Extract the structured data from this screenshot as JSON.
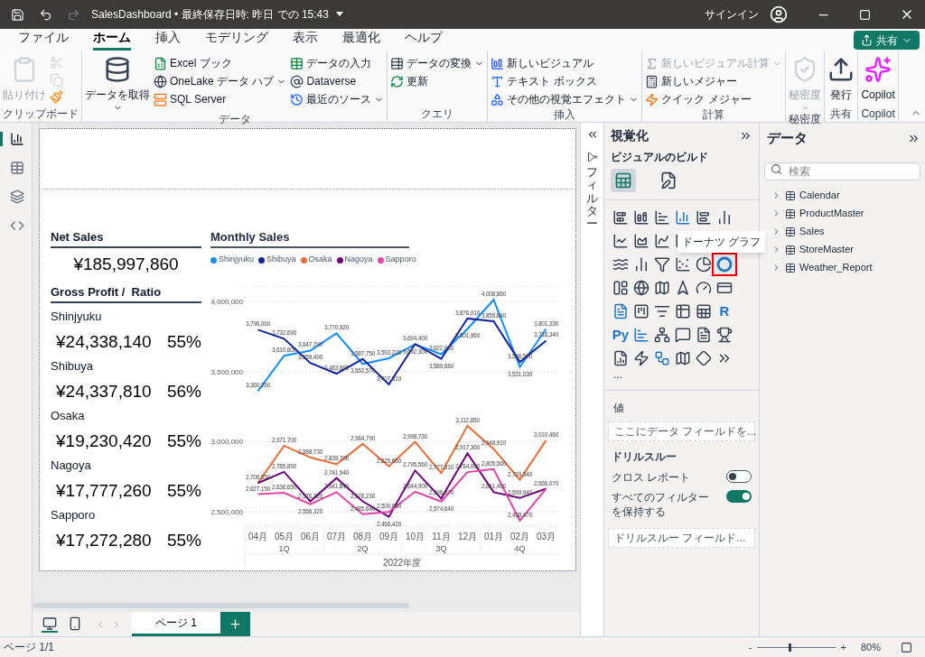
{
  "window": {
    "title": "SalesDashboard • 最終保存日時: 昨日 での 15:43",
    "signin": "サインイン"
  },
  "menu_tabs": [
    {
      "label": "ファイル",
      "selected": false
    },
    {
      "label": "ホーム",
      "selected": true
    },
    {
      "label": "挿入",
      "selected": false
    },
    {
      "label": "モデリング",
      "selected": false
    },
    {
      "label": "表示",
      "selected": false
    },
    {
      "label": "最適化",
      "selected": false
    },
    {
      "label": "ヘルプ",
      "selected": false
    }
  ],
  "share_button": "共有",
  "clipboard_tools": [
    {
      "disabled": true
    },
    {
      "disabled": true
    },
    {
      "disabled": false
    }
  ],
  "ribbon_groups": [
    {
      "label": "クリップボード",
      "large": {
        "label": "貼り付け",
        "dropdown": false,
        "disabled": true
      }
    },
    {
      "label": "データ",
      "large": {
        "label": "データを取得",
        "dropdown": true,
        "disabled": false
      },
      "small": [
        {
          "label": "Excel ブック",
          "dropdown": false,
          "disabled": false
        },
        {
          "label": "OneLake データ ハブ",
          "dropdown": true,
          "disabled": false
        },
        {
          "label": "SQL Server",
          "dropdown": false,
          "disabled": false
        },
        {
          "label": "データの入力",
          "dropdown": false,
          "disabled": false
        },
        {
          "label": "Dataverse",
          "dropdown": false,
          "disabled": false
        },
        {
          "label": "最近のソース",
          "dropdown": true,
          "disabled": false
        }
      ]
    },
    {
      "label": "クエリ",
      "small": [
        {
          "label": "データの変換",
          "dropdown": true,
          "disabled": false
        },
        {
          "label": "更新",
          "dropdown": false,
          "disabled": false
        }
      ]
    },
    {
      "label": "挿入",
      "small": [
        {
          "label": "新しいビジュアル",
          "dropdown": false,
          "disabled": false
        },
        {
          "label": "テキスト ボックス",
          "dropdown": false,
          "disabled": false
        },
        {
          "label": "その他の視覚エフェクト",
          "dropdown": true,
          "disabled": false
        }
      ]
    },
    {
      "label": "計算",
      "small": [
        {
          "label": "新しいビジュアル計算",
          "dropdown": true,
          "disabled": true
        },
        {
          "label": "新しいメジャー",
          "dropdown": false,
          "disabled": false
        },
        {
          "label": "クイック メジャー",
          "dropdown": false,
          "disabled": false
        }
      ]
    },
    {
      "label": "秘密度",
      "large": {
        "label": "秘密度",
        "dropdown": true,
        "disabled": true
      }
    },
    {
      "label": "共有",
      "large": {
        "label": "発行",
        "dropdown": false,
        "disabled": false
      }
    },
    {
      "label": "Copilot",
      "large": {
        "label": "Copilot",
        "dropdown": false,
        "disabled": false
      }
    }
  ],
  "views": [
    {
      "selected": true
    },
    {
      "selected": false
    },
    {
      "selected": false
    },
    {
      "selected": false
    }
  ],
  "kpi": {
    "net_sales_title": "Net Sales",
    "net_sales_value": "¥185,997,860",
    "gross_title": "Gross Profit /  Ratio",
    "stores": [
      {
        "name": "Shinjyuku",
        "profit": "¥24,338,140",
        "ratio": "55%"
      },
      {
        "name": "Shibuya",
        "profit": "¥24,337,810",
        "ratio": "56%"
      },
      {
        "name": "Osaka",
        "profit": "¥19,230,420",
        "ratio": "55%"
      },
      {
        "name": "Nagoya",
        "profit": "¥17,777,260",
        "ratio": "55%"
      },
      {
        "name": "Sapporo",
        "profit": "¥17,272,280",
        "ratio": "55%"
      }
    ]
  },
  "chart": {
    "title": "Monthly Sales",
    "quarters": [
      "1Q",
      "2Q",
      "3Q",
      "4Q"
    ],
    "fiscal_year": "2022年度",
    "chart_data": {
      "type": "line",
      "categories": [
        "04月",
        "05月",
        "06月",
        "07月",
        "08月",
        "09月",
        "10月",
        "11月",
        "12月",
        "01月",
        "02月",
        "03月"
      ],
      "series": [
        {
          "name": "Shinjyuku",
          "color": "#118dff",
          "values": [
            3360260,
            3610800,
            3647790,
            3770920,
            3552570,
            3593220,
            3692300,
            3622080,
            3801960,
            4008860,
            3531030,
            3801330
          ],
          "value_labels": [
            "3,360,260",
            "3,610,800",
            "3,647,790",
            "3,770,920",
            "3,552,570",
            "3,593,220",
            "3,692,300",
            "3,622,080",
            "3,801,960",
            "4,008,860",
            "3,531,030",
            "3,801,330"
          ]
        },
        {
          "name": "Shibuya",
          "color": "#12239e",
          "values": [
            3796060,
            3732690,
            3559490,
            3483880,
            3587750,
            3407810,
            3694400,
            3589680,
            3876010,
            3855840,
            3566590,
            3718340
          ],
          "value_labels": [
            "3,796,060",
            "3,732,690",
            "3,559,490",
            "3,483,880",
            "3,587,750",
            "3,407,810",
            "3,694,400",
            "3,589,680",
            "3,876,010",
            "3,855,840",
            "3,566,590",
            "3,718,340"
          ]
        },
        {
          "name": "Osaka",
          "color": "#e66c37",
          "values": [
            2706050,
            2971700,
            2888730,
            2839700,
            2984790,
            2825660,
            2998730,
            2777310,
            3112850,
            2948910,
            2729340,
            3010460
          ],
          "value_labels": [
            "2,706,050",
            "2,971,700",
            "2,888,730",
            "2,839,700",
            "2,984,790",
            "2,825,660",
            "2,998,730",
            "2,777,310",
            "3,112,850",
            "2,948,910",
            "2,729,340",
            "3,010,460"
          ]
        },
        {
          "name": "Nagoya",
          "color": "#6b007b",
          "values": [
            2706050,
            2785890,
            2576320,
            2741940,
            2576230,
            2466420,
            2795560,
            2596870,
            2917360,
            2641490,
            2599940,
            2666070
          ],
          "value_labels": [
            null,
            "2,785,890",
            "2,576,320",
            "2,741,940",
            "2,576,230",
            "2,466,420",
            "2,795,560",
            "2,596,870",
            "2,917,360",
            "2,641,490",
            "2,599,940",
            "2,666,070"
          ]
        },
        {
          "name": "Sapporo",
          "color": "#e044a7",
          "values": [
            2627150,
            2636650,
            2556320,
            2641840,
            2485640,
            2500860,
            2644900,
            2574640,
            2784080,
            2805560,
            2438470,
            2666070
          ],
          "value_labels": [
            "2,627,150",
            "2,636,650",
            "2,556,320",
            "2,641,840",
            "2,485,640",
            "2,500,860",
            "2,644,900",
            "2,574,640",
            "2,784,080",
            "2,805,560",
            "2,438,470",
            null
          ]
        }
      ],
      "ylim": [
        2400000,
        4100000
      ],
      "yticks": [
        {
          "value": 2500000,
          "label": "2,500,000"
        },
        {
          "value": 3000000,
          "label": "3,000,000"
        },
        {
          "value": 3500000,
          "label": "3,500,000"
        },
        {
          "value": 4000000,
          "label": "4,000,000"
        }
      ],
      "grid": true
    }
  },
  "filter_pane": {
    "label": "フィルター"
  },
  "visualizations": {
    "title": "視覚化",
    "build_label": "ビジュアルのビルド",
    "build_tabs": [
      {
        "selected": true
      },
      {
        "selected": false
      }
    ],
    "gallery": [
      {
        "highlighted": false
      },
      {
        "highlighted": false
      },
      {
        "highlighted": false
      },
      {
        "highlighted": false
      },
      {
        "highlighted": false
      },
      {
        "highlighted": false
      },
      {
        "highlighted": false
      },
      {
        "highlighted": false
      },
      {
        "highlighted": false
      },
      {
        "highlighted": false
      },
      {
        "highlighted": false
      },
      {
        "highlighted": false
      },
      {
        "highlighted": false
      },
      {
        "highlighted": false
      },
      {
        "highlighted": false
      },
      {
        "highlighted": false
      },
      {
        "highlighted": false
      },
      {
        "highlighted": true,
        "tooltip": "ドーナツ グラフ"
      },
      {
        "highlighted": false
      },
      {
        "highlighted": false
      },
      {
        "highlighted": false
      },
      {
        "highlighted": false
      },
      {
        "highlighted": false
      },
      {
        "highlighted": false
      },
      {
        "highlighted": false
      },
      {
        "highlighted": false
      },
      {
        "highlighted": false
      },
      {
        "highlighted": false
      },
      {
        "highlighted": false
      },
      {
        "highlighted": false,
        "text": "R"
      },
      {
        "highlighted": false,
        "text": "Py"
      },
      {
        "highlighted": false
      },
      {
        "highlighted": false
      },
      {
        "highlighted": false
      },
      {
        "highlighted": false
      },
      {
        "highlighted": false
      },
      {
        "highlighted": false
      },
      {
        "highlighted": false
      },
      {
        "highlighted": false
      },
      {
        "highlighted": false
      },
      {
        "highlighted": false
      },
      {
        "highlighted": false
      }
    ],
    "more": "...",
    "values_label": "値",
    "values_placeholder": "ここにデータ フィールドを...",
    "drillthrough_title": "ドリルスルー",
    "toggles": [
      {
        "label": "クロス レポート",
        "on": false
      },
      {
        "label": "すべてのフィルターを保持する",
        "on": true
      }
    ],
    "drillthrough_placeholder": "ドリルスルー フィールド..."
  },
  "data_pane": {
    "title": "データ",
    "search_placeholder": "検索",
    "tables": [
      {
        "name": "Calendar",
        "expanded": false
      },
      {
        "name": "ProductMaster",
        "expanded": false
      },
      {
        "name": "Sales",
        "expanded": false
      },
      {
        "name": "StoreMaster",
        "expanded": false
      },
      {
        "name": "Weather_Report",
        "expanded": false
      }
    ]
  },
  "view_modes": [
    {
      "selected": true
    },
    {
      "selected": false
    }
  ],
  "page_tabs": [
    {
      "label": "ページ 1",
      "selected": true
    }
  ],
  "status_bar": {
    "page": "ページ 1/1",
    "zoom_out": "-",
    "zoom_in": "+",
    "zoom": "80%",
    "zoom_slider": {
      "level": 0.4
    }
  }
}
